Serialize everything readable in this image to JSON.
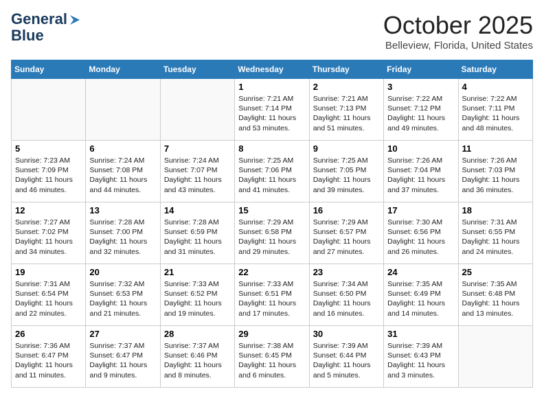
{
  "header": {
    "logo_line1": "General",
    "logo_line2": "Blue",
    "month": "October 2025",
    "location": "Belleview, Florida, United States"
  },
  "days_of_week": [
    "Sunday",
    "Monday",
    "Tuesday",
    "Wednesday",
    "Thursday",
    "Friday",
    "Saturday"
  ],
  "weeks": [
    [
      {
        "day": "",
        "info": ""
      },
      {
        "day": "",
        "info": ""
      },
      {
        "day": "",
        "info": ""
      },
      {
        "day": "1",
        "info": "Sunrise: 7:21 AM\nSunset: 7:14 PM\nDaylight: 11 hours\nand 53 minutes."
      },
      {
        "day": "2",
        "info": "Sunrise: 7:21 AM\nSunset: 7:13 PM\nDaylight: 11 hours\nand 51 minutes."
      },
      {
        "day": "3",
        "info": "Sunrise: 7:22 AM\nSunset: 7:12 PM\nDaylight: 11 hours\nand 49 minutes."
      },
      {
        "day": "4",
        "info": "Sunrise: 7:22 AM\nSunset: 7:11 PM\nDaylight: 11 hours\nand 48 minutes."
      }
    ],
    [
      {
        "day": "5",
        "info": "Sunrise: 7:23 AM\nSunset: 7:09 PM\nDaylight: 11 hours\nand 46 minutes."
      },
      {
        "day": "6",
        "info": "Sunrise: 7:24 AM\nSunset: 7:08 PM\nDaylight: 11 hours\nand 44 minutes."
      },
      {
        "day": "7",
        "info": "Sunrise: 7:24 AM\nSunset: 7:07 PM\nDaylight: 11 hours\nand 43 minutes."
      },
      {
        "day": "8",
        "info": "Sunrise: 7:25 AM\nSunset: 7:06 PM\nDaylight: 11 hours\nand 41 minutes."
      },
      {
        "day": "9",
        "info": "Sunrise: 7:25 AM\nSunset: 7:05 PM\nDaylight: 11 hours\nand 39 minutes."
      },
      {
        "day": "10",
        "info": "Sunrise: 7:26 AM\nSunset: 7:04 PM\nDaylight: 11 hours\nand 37 minutes."
      },
      {
        "day": "11",
        "info": "Sunrise: 7:26 AM\nSunset: 7:03 PM\nDaylight: 11 hours\nand 36 minutes."
      }
    ],
    [
      {
        "day": "12",
        "info": "Sunrise: 7:27 AM\nSunset: 7:02 PM\nDaylight: 11 hours\nand 34 minutes."
      },
      {
        "day": "13",
        "info": "Sunrise: 7:28 AM\nSunset: 7:00 PM\nDaylight: 11 hours\nand 32 minutes."
      },
      {
        "day": "14",
        "info": "Sunrise: 7:28 AM\nSunset: 6:59 PM\nDaylight: 11 hours\nand 31 minutes."
      },
      {
        "day": "15",
        "info": "Sunrise: 7:29 AM\nSunset: 6:58 PM\nDaylight: 11 hours\nand 29 minutes."
      },
      {
        "day": "16",
        "info": "Sunrise: 7:29 AM\nSunset: 6:57 PM\nDaylight: 11 hours\nand 27 minutes."
      },
      {
        "day": "17",
        "info": "Sunrise: 7:30 AM\nSunset: 6:56 PM\nDaylight: 11 hours\nand 26 minutes."
      },
      {
        "day": "18",
        "info": "Sunrise: 7:31 AM\nSunset: 6:55 PM\nDaylight: 11 hours\nand 24 minutes."
      }
    ],
    [
      {
        "day": "19",
        "info": "Sunrise: 7:31 AM\nSunset: 6:54 PM\nDaylight: 11 hours\nand 22 minutes."
      },
      {
        "day": "20",
        "info": "Sunrise: 7:32 AM\nSunset: 6:53 PM\nDaylight: 11 hours\nand 21 minutes."
      },
      {
        "day": "21",
        "info": "Sunrise: 7:33 AM\nSunset: 6:52 PM\nDaylight: 11 hours\nand 19 minutes."
      },
      {
        "day": "22",
        "info": "Sunrise: 7:33 AM\nSunset: 6:51 PM\nDaylight: 11 hours\nand 17 minutes."
      },
      {
        "day": "23",
        "info": "Sunrise: 7:34 AM\nSunset: 6:50 PM\nDaylight: 11 hours\nand 16 minutes."
      },
      {
        "day": "24",
        "info": "Sunrise: 7:35 AM\nSunset: 6:49 PM\nDaylight: 11 hours\nand 14 minutes."
      },
      {
        "day": "25",
        "info": "Sunrise: 7:35 AM\nSunset: 6:48 PM\nDaylight: 11 hours\nand 13 minutes."
      }
    ],
    [
      {
        "day": "26",
        "info": "Sunrise: 7:36 AM\nSunset: 6:47 PM\nDaylight: 11 hours\nand 11 minutes."
      },
      {
        "day": "27",
        "info": "Sunrise: 7:37 AM\nSunset: 6:47 PM\nDaylight: 11 hours\nand 9 minutes."
      },
      {
        "day": "28",
        "info": "Sunrise: 7:37 AM\nSunset: 6:46 PM\nDaylight: 11 hours\nand 8 minutes."
      },
      {
        "day": "29",
        "info": "Sunrise: 7:38 AM\nSunset: 6:45 PM\nDaylight: 11 hours\nand 6 minutes."
      },
      {
        "day": "30",
        "info": "Sunrise: 7:39 AM\nSunset: 6:44 PM\nDaylight: 11 hours\nand 5 minutes."
      },
      {
        "day": "31",
        "info": "Sunrise: 7:39 AM\nSunset: 6:43 PM\nDaylight: 11 hours\nand 3 minutes."
      },
      {
        "day": "",
        "info": ""
      }
    ]
  ]
}
